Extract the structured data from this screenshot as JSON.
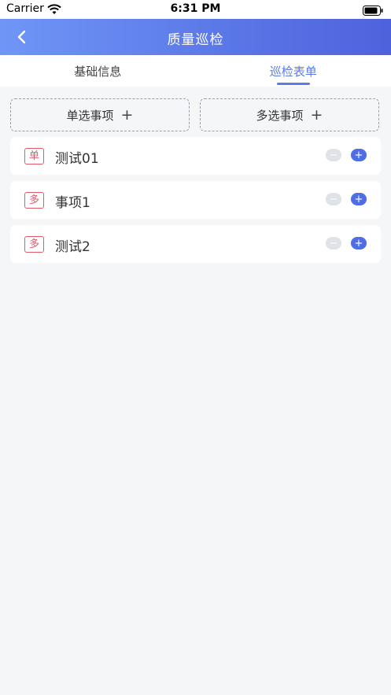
{
  "status_bar": {
    "carrier": "Carrier",
    "time": "6:31 PM"
  },
  "header": {
    "title": "质量巡检"
  },
  "tabs": [
    {
      "label": "基础信息",
      "active": false
    },
    {
      "label": "巡检表单",
      "active": true
    }
  ],
  "add_buttons": {
    "single": "单选事项",
    "multi": "多选事项",
    "plus_symbol": "+"
  },
  "items": [
    {
      "badge": "单",
      "label": "测试01"
    },
    {
      "badge": "多",
      "label": "事项1"
    },
    {
      "badge": "多",
      "label": "测试2"
    }
  ],
  "colors": {
    "accent": "#5b7be8",
    "badge": "#e05a6a",
    "background": "#f5f6f8"
  }
}
